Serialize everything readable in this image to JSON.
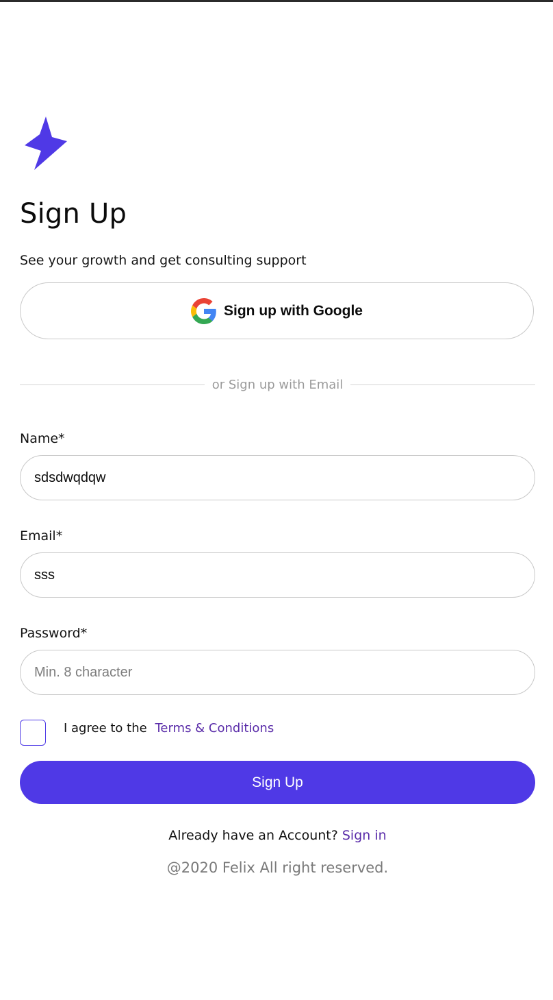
{
  "brand": {
    "accent": "#4f39e6",
    "link": "#5a2ca9",
    "logo_icon": "lightning-bolt-icon"
  },
  "header": {
    "title": "Sign Up",
    "subtitle": "See your growth and get consulting support"
  },
  "google": {
    "label": "Sign up with Google",
    "icon": "google-icon"
  },
  "divider": {
    "text": "or Sign up with Email"
  },
  "form": {
    "name": {
      "label": "Name*",
      "value": "sdsdwqdqw",
      "placeholder": ""
    },
    "email": {
      "label": "Email*",
      "value": "sss",
      "placeholder": ""
    },
    "password": {
      "label": "Password*",
      "value": "",
      "placeholder": "Min. 8 character"
    },
    "agree_text": "I agree to the",
    "terms_link": "Terms & Conditions",
    "submit_label": "Sign Up"
  },
  "footer": {
    "account_text": "Already have an Account?",
    "signin_link": "Sign in",
    "copyright": "@2020 Felix All right reserved."
  }
}
